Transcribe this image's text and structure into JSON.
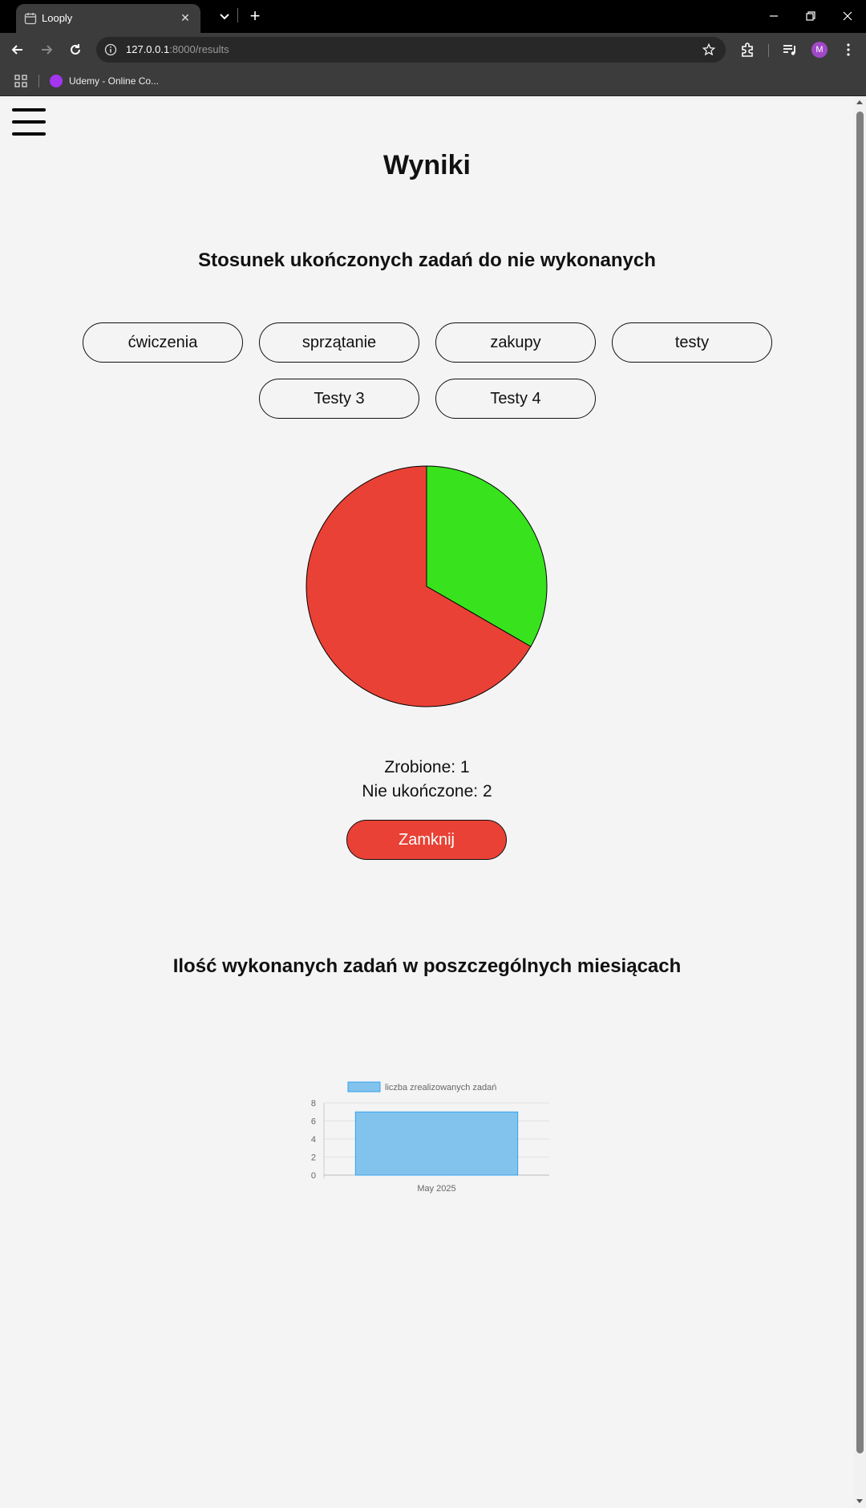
{
  "browser": {
    "tab_title": "Looply",
    "url_host": "127.0.0.1",
    "url_rest": ":8000/results",
    "bookmark_label": "Udemy - Online Co...",
    "profile_initial": "M"
  },
  "page": {
    "title": "Wyniki",
    "ratio_section_title": "Stosunek ukończonych zadań do nie wykonanych",
    "categories": [
      "ćwiczenia",
      "sprzątanie",
      "zakupy",
      "testy",
      "Testy 3",
      "Testy 4"
    ],
    "done_text": "Zrobione: 1",
    "not_done_text": "Nie ukończone: 2",
    "close_label": "Zamknij",
    "monthly_section_title": "Ilość wykonanych zadań w poszczególnych miesiącach"
  },
  "colors": {
    "done": "#38e31e",
    "not_done": "#e94136",
    "bar_fill": "#82c3ee",
    "bar_border": "#36a2eb"
  },
  "chart_data": [
    {
      "type": "pie",
      "categories": [
        "Zrobione",
        "Nie ukończone"
      ],
      "values": [
        1,
        2
      ],
      "colors": [
        "#38e31e",
        "#e94136"
      ]
    },
    {
      "type": "bar",
      "categories": [
        "May 2025"
      ],
      "series": [
        {
          "name": "liczba zrealizowanych zadań",
          "values": [
            7
          ]
        }
      ],
      "ylim": [
        0,
        8
      ],
      "yticks": [
        0,
        2,
        4,
        6,
        8
      ],
      "grid": true,
      "legend": "top"
    }
  ]
}
